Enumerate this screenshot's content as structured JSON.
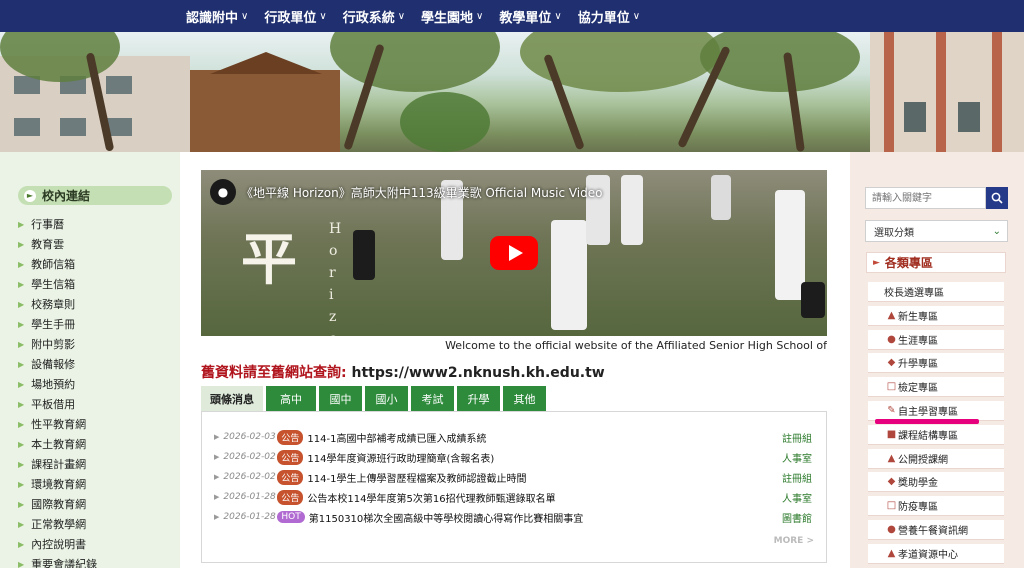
{
  "nav": {
    "items": [
      {
        "label": "認識附中",
        "chevron": "∨"
      },
      {
        "label": "行政單位",
        "chevron": "∨"
      },
      {
        "label": "行政系統",
        "chevron": "∨"
      },
      {
        "label": "學生園地",
        "chevron": "∨"
      },
      {
        "label": "教學單位",
        "chevron": "∨"
      },
      {
        "label": "協力單位",
        "chevron": "∨"
      }
    ]
  },
  "left_sidebar": {
    "title": "校內連結",
    "items": [
      "行事曆",
      "教育雲",
      "教師信箱",
      "學生信箱",
      "校務章則",
      "學生手冊",
      "附中剪影",
      "設備報修",
      "場地預約",
      "平板借用",
      "性平教育網",
      "本土教育網",
      "課程計畫網",
      "環境教育網",
      "國際教育網",
      "正常教學網",
      "內控說明書",
      "重要會議紀錄"
    ]
  },
  "video": {
    "title": "《地平線 Horizon》高師大附中113級畢業歌 Official Music Video",
    "calligraphy_main": "平",
    "calligraphy_small": "H o r i z o"
  },
  "marquee": "Welcome to the official website of the Affiliated Senior High School of",
  "old_site": {
    "label": "舊資料請至舊網站查詢:",
    "url": "https://www2.nknush.kh.edu.tw"
  },
  "tabs": [
    "頭條消息",
    "高中",
    "國中",
    "國小",
    "考試",
    "升學",
    "其他"
  ],
  "news": [
    {
      "date": "2026-02-03",
      "badge": "公告",
      "badge_color": "#c6532e",
      "text": "114-1高國中部補考成績已匯入成績系統",
      "unit": "註冊組"
    },
    {
      "date": "2026-02-02",
      "badge": "公告",
      "badge_color": "#c6532e",
      "text": "114學年度資源班行政助理簡章(含報名表)",
      "unit": "人事室"
    },
    {
      "date": "2026-02-02",
      "badge": "公告",
      "badge_color": "#c6532e",
      "text": "114-1學生上傳學習歷程檔案及教師認證截止時間",
      "unit": "註冊組"
    },
    {
      "date": "2026-01-28",
      "badge": "公告",
      "badge_color": "#c6532e",
      "text": "公告本校114學年度第5次第16招代理教師甄選錄取名單",
      "unit": "人事室"
    },
    {
      "date": "2026-01-28",
      "badge": "HOT",
      "badge_color": "#b06ad1",
      "text": "第1150310梯次全國高級中等學校閱讀心得寫作比賽相關事宜",
      "unit": "圖書館"
    }
  ],
  "news_more": "MORE >",
  "right_sidebar": {
    "search_placeholder": "請輸入關鍵字",
    "select_label": "選取分類",
    "category_title": "各類專區",
    "zones": [
      {
        "label": "校長遴選專區",
        "icon": "none"
      },
      {
        "label": "新生專區",
        "icon": "newbie-icon"
      },
      {
        "label": "生涯專區",
        "icon": "career-icon"
      },
      {
        "label": "升學專區",
        "icon": "graduation-icon"
      },
      {
        "label": "檢定專區",
        "icon": "certificate-icon"
      },
      {
        "label": "自主學習專區",
        "icon": "self-study-icon"
      },
      {
        "label": "課程結構專區",
        "icon": "curriculum-icon"
      },
      {
        "label": "公開授課網",
        "icon": "open-class-icon"
      },
      {
        "label": "獎助學金",
        "icon": "scholarship-icon"
      },
      {
        "label": "防疫專區",
        "icon": "epidemic-icon"
      },
      {
        "label": "營養午餐資訊網",
        "icon": "lunch-icon"
      },
      {
        "label": "孝道資源中心",
        "icon": "filial-icon"
      }
    ]
  },
  "colors": {
    "nav_bg": "#1f2f6f",
    "tab_green": "#2e8b3c",
    "accent_red": "#b0141c",
    "highlight_magenta": "#e6007e",
    "search_btn": "#263a8a"
  }
}
